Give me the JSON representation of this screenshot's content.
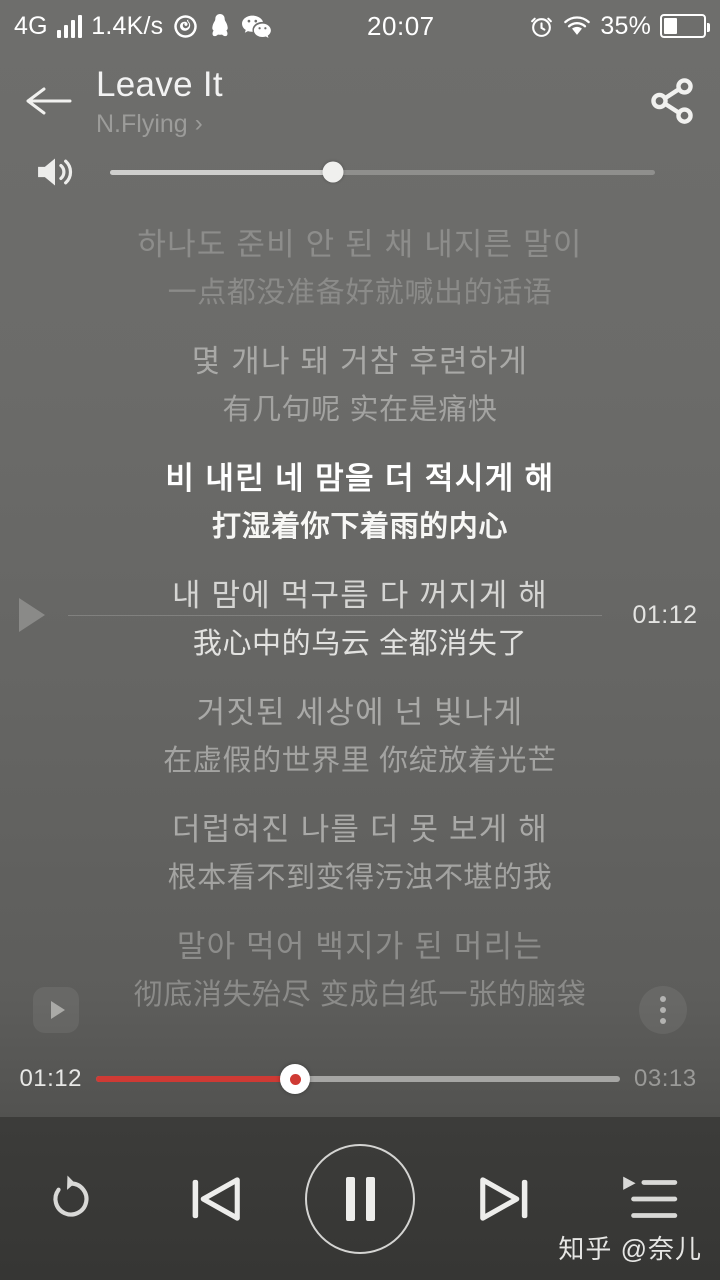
{
  "status_bar": {
    "network_type": "4G",
    "signal_icon": "signal-bars-icon",
    "data_speed": "1.4K/s",
    "app_icons": [
      "netease-music-icon",
      "qq-icon",
      "wechat-icon"
    ],
    "time": "20:07",
    "alarm_icon": "alarm-clock-icon",
    "wifi_icon": "wifi-icon",
    "battery_percent": "35%",
    "battery_level": 35
  },
  "header": {
    "back_icon": "back-arrow-icon",
    "song_title": "Leave It",
    "artist": "N.Flying",
    "artist_chevron": "chevron-right-icon",
    "share_icon": "share-icon"
  },
  "volume": {
    "icon": "volume-speaker-icon",
    "level_percent": 41
  },
  "lyrics": {
    "lines": [
      {
        "original": "하나도 준비 안 된 채 내지른 말이",
        "translation": "一点都没准备好就喊出的话语",
        "state": "dim"
      },
      {
        "original": "몇 개나 돼 거참 후련하게",
        "translation": "有几句呢 实在是痛快",
        "state": "normal"
      },
      {
        "original": "비 내린 네 맘을 더 적시게 해",
        "translation": "打湿着你下着雨的内心",
        "state": "active"
      },
      {
        "original": "내 맘에 먹구름 다 꺼지게 해",
        "translation": "我心中的乌云 全都消失了",
        "state": "next"
      },
      {
        "original": "거짓된 세상에 넌 빛나게",
        "translation": "在虚假的世界里 你绽放着光芒",
        "state": "normal"
      },
      {
        "original": "더럽혀진 나를 더 못 보게 해",
        "translation": "根本看不到变得污浊不堪的我",
        "state": "normal"
      },
      {
        "original": "말아 먹어 백지가 된 머리는",
        "translation": "彻底消失殆尽 变成白纸一张的脑袋",
        "state": "dim"
      }
    ]
  },
  "seek_indicator": {
    "play_icon": "play-triangle-icon",
    "time": "01:12"
  },
  "floating": {
    "mini_play_icon": "play-triangle-icon",
    "more_icon": "more-vertical-icon"
  },
  "progress": {
    "elapsed": "01:12",
    "total": "03:13",
    "percent": 38,
    "accent_color": "#cf3a34"
  },
  "controls": {
    "repeat_icon": "repeat-loop-icon",
    "previous_icon": "previous-track-icon",
    "play_pause_icon": "pause-icon",
    "next_icon": "next-track-icon",
    "playlist_icon": "playlist-queue-icon"
  },
  "watermark": "知乎 @奈儿"
}
